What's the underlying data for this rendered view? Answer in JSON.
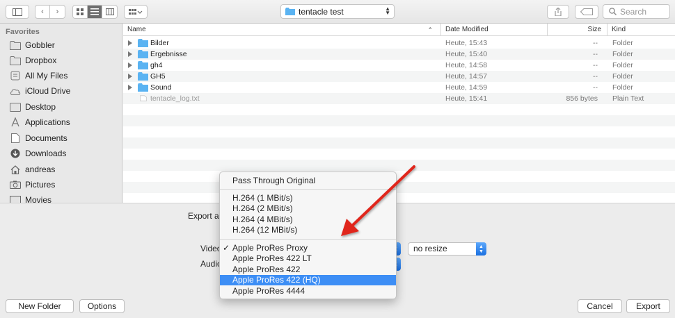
{
  "toolbar": {
    "folder": "tentacle test",
    "search_placeholder": "Search"
  },
  "sidebar": {
    "heading": "Favorites",
    "items": [
      {
        "label": "Gobbler",
        "icon": "folder-icon"
      },
      {
        "label": "Dropbox",
        "icon": "folder-icon"
      },
      {
        "label": "All My Files",
        "icon": "all-files-icon"
      },
      {
        "label": "iCloud Drive",
        "icon": "cloud-icon"
      },
      {
        "label": "Desktop",
        "icon": "desktop-icon"
      },
      {
        "label": "Applications",
        "icon": "applications-icon"
      },
      {
        "label": "Documents",
        "icon": "documents-icon"
      },
      {
        "label": "Downloads",
        "icon": "downloads-icon"
      },
      {
        "label": "andreas",
        "icon": "home-icon"
      },
      {
        "label": "Pictures",
        "icon": "pictures-icon"
      },
      {
        "label": "Movies",
        "icon": "movies-icon"
      }
    ]
  },
  "filelist": {
    "columns": [
      "Name",
      "Date Modified",
      "Size",
      "Kind"
    ],
    "rows": [
      {
        "name": "Bilder",
        "date": "Heute, 15:43",
        "size": "--",
        "kind": "Folder",
        "folder": true
      },
      {
        "name": "Ergebnisse",
        "date": "Heute, 15:40",
        "size": "--",
        "kind": "Folder",
        "folder": true
      },
      {
        "name": "gh4",
        "date": "Heute, 14:58",
        "size": "--",
        "kind": "Folder",
        "folder": true
      },
      {
        "name": "GH5",
        "date": "Heute, 14:57",
        "size": "--",
        "kind": "Folder",
        "folder": true
      },
      {
        "name": "Sound",
        "date": "Heute, 14:59",
        "size": "--",
        "kind": "Folder",
        "folder": true
      },
      {
        "name": "tentacle_log.txt",
        "date": "Heute, 15:41",
        "size": "856 bytes",
        "kind": "Plain Text",
        "folder": false
      }
    ]
  },
  "options": {
    "export_as_label": "Export as",
    "video_label": "Video:",
    "audio_label": "Audio:",
    "resize_value": "no resize"
  },
  "menu": {
    "groups": [
      [
        {
          "label": "Pass Through Original"
        }
      ],
      [
        {
          "label": "H.264 (1 MBit/s)"
        },
        {
          "label": "H.264 (2 MBit/s)"
        },
        {
          "label": "H.264 (4 MBit/s)"
        },
        {
          "label": "H.264 (12 MBit/s)"
        }
      ],
      [
        {
          "label": "Apple ProRes Proxy",
          "checked": true
        },
        {
          "label": "Apple ProRes 422 LT"
        },
        {
          "label": "Apple ProRes 422"
        },
        {
          "label": "Apple ProRes 422 (HQ)",
          "highlighted": true
        },
        {
          "label": "Apple ProRes 4444"
        }
      ]
    ]
  },
  "buttons": {
    "new_folder": "New Folder",
    "options": "Options",
    "cancel": "Cancel",
    "export": "Export"
  },
  "colors": {
    "accent": "#3d8ef5",
    "folder": "#5ab3f2",
    "annotation_arrow": "#e0251b"
  }
}
